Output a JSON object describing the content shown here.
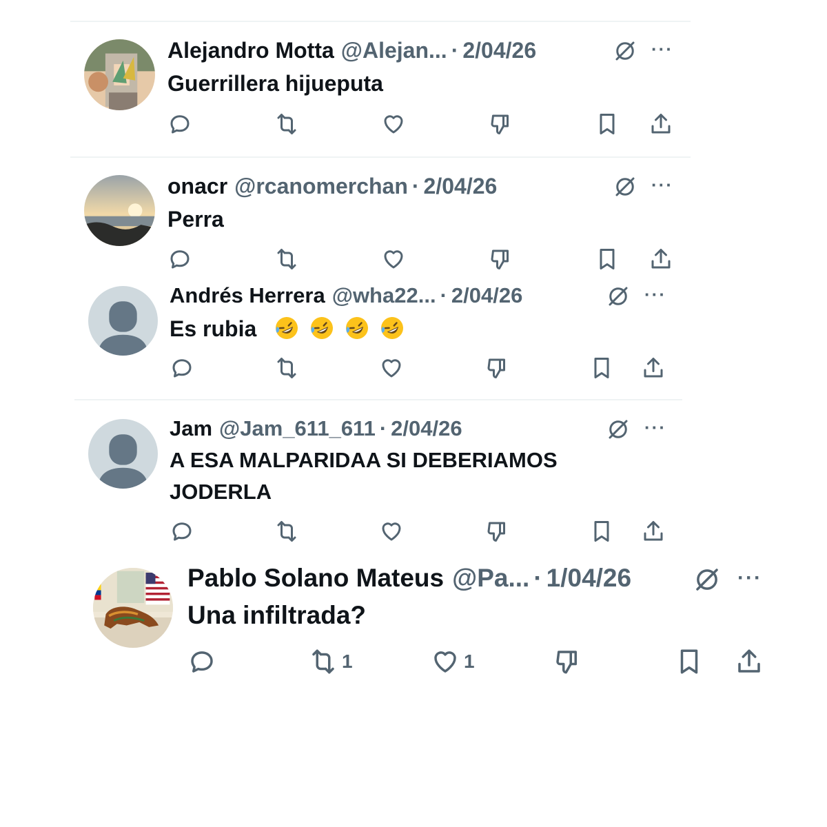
{
  "icons": {
    "reply": "reply-icon",
    "repost": "repost-icon",
    "like": "heart-icon",
    "dislike": "dislike-icon",
    "bookmark": "bookmark-icon",
    "share": "share-icon",
    "grok": "grok-icon",
    "more": "more-icon"
  },
  "colors": {
    "text": "#0f1419",
    "muted": "#536471",
    "divider": "#eff3f4",
    "default_avatar_bg": "#cfd9de",
    "default_avatar_fg": "#657786"
  },
  "posts": [
    {
      "name": "Alejandro Motta",
      "handle": "@Alejan...",
      "dot": "·",
      "date": "2/04/26",
      "text": "Guerrillera hijueputa",
      "more": "···",
      "reply_count": "",
      "repost_count": "",
      "like_count": ""
    },
    {
      "name": "onacr",
      "handle": "@rcanomerchan",
      "dot": "·",
      "date": "2/04/26",
      "text": "Perra",
      "more": "···",
      "reply_count": "",
      "repost_count": "",
      "like_count": ""
    },
    {
      "name": "Andrés Herrera",
      "handle": "@wha22...",
      "dot": "·",
      "date": "2/04/26",
      "text": "Es rubia",
      "emoji_count": 4,
      "more": "···",
      "reply_count": "",
      "repost_count": "",
      "like_count": ""
    },
    {
      "name": "Jam",
      "handle": "@Jam_611_611",
      "dot": "·",
      "date": "2/04/26",
      "text_line1": "A ESA MALPARIDAA SI DEBERIAMOS",
      "text_line2": "JODERLA",
      "more": "···",
      "reply_count": "",
      "repost_count": "",
      "like_count": ""
    },
    {
      "name": "Pablo Solano Mateus",
      "handle": "@Pa...",
      "dot": "·",
      "date": "1/04/26",
      "text": "Una infiltrada?",
      "more": "···",
      "reply_count": "",
      "repost_count": "1",
      "like_count": "1"
    }
  ]
}
